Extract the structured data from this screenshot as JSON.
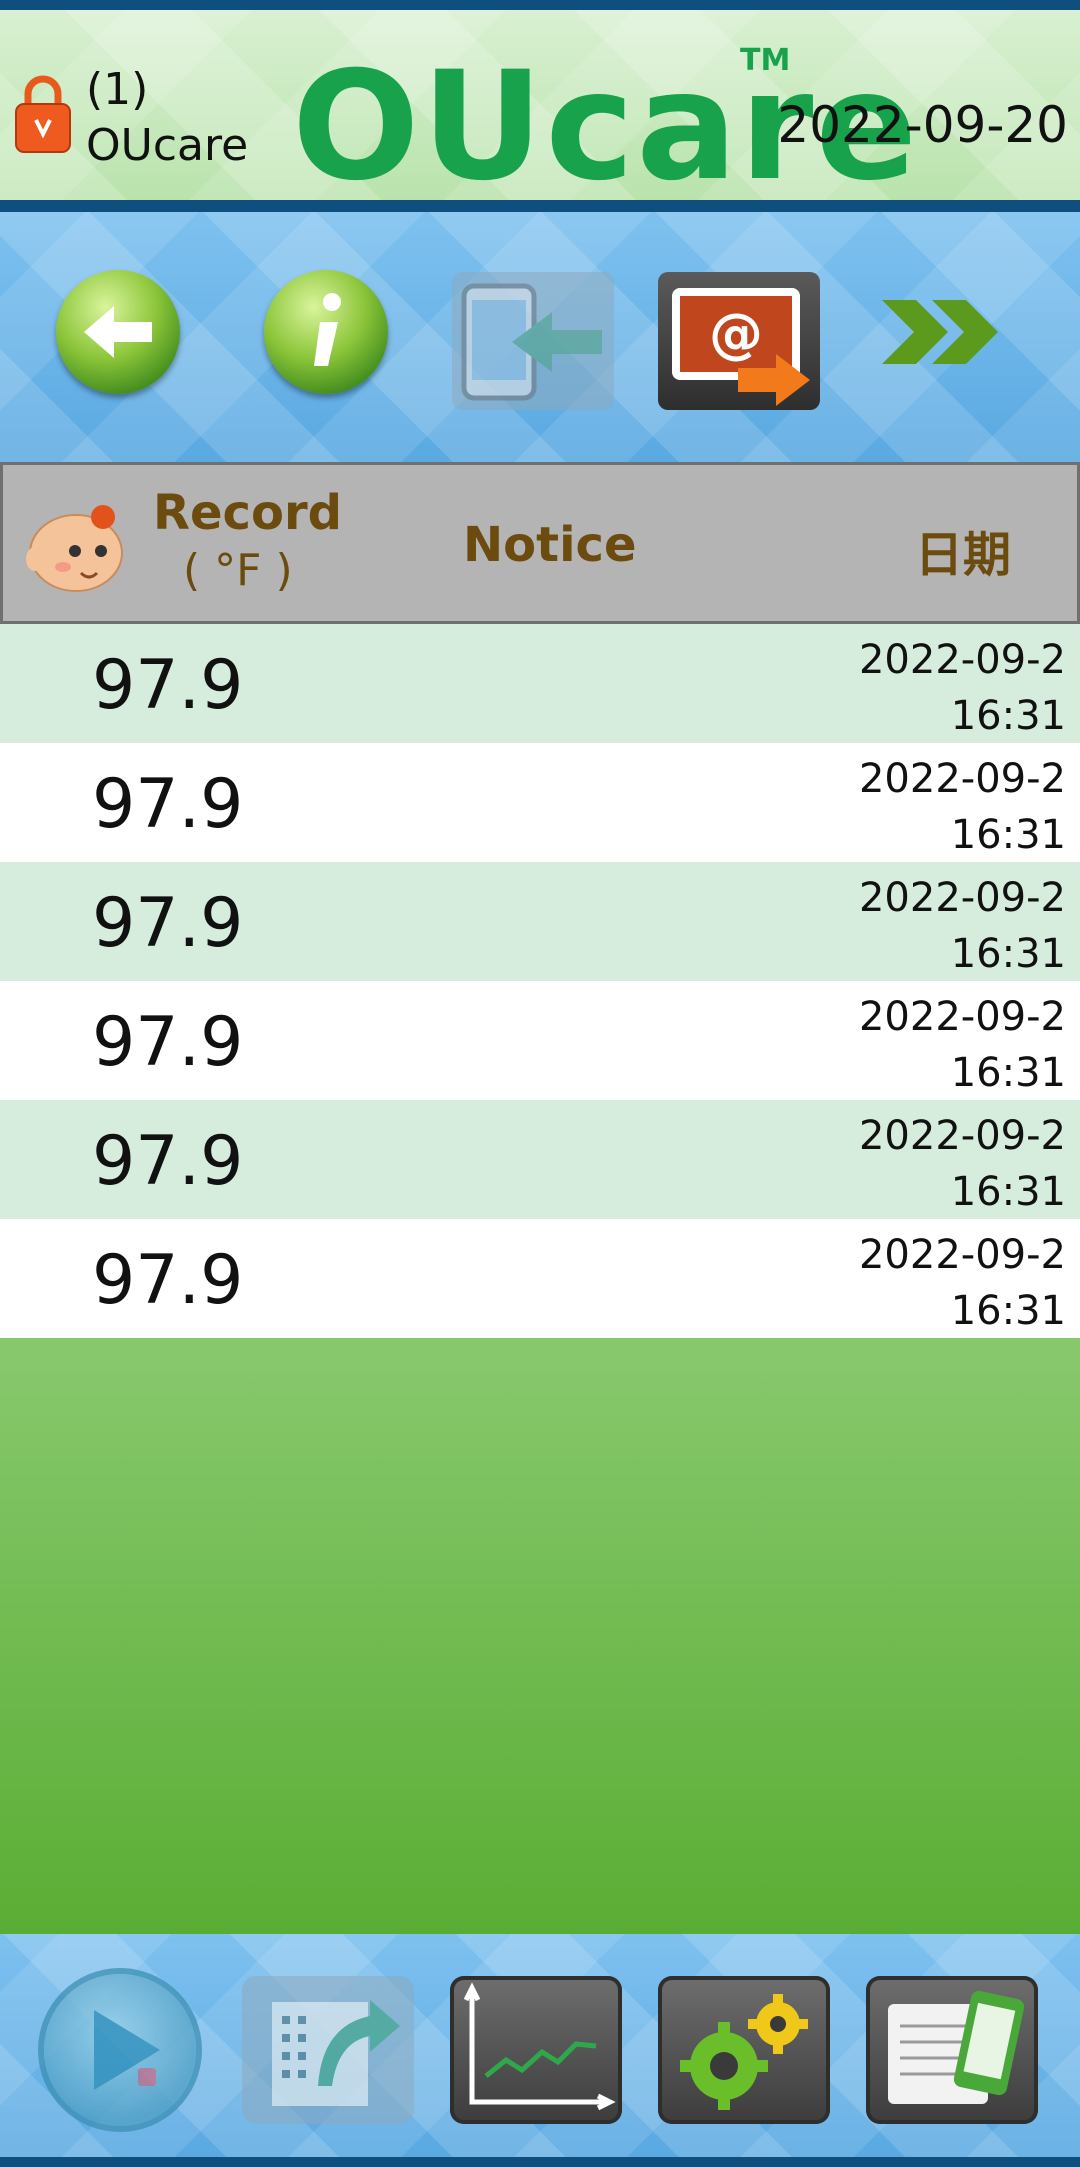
{
  "header": {
    "user_index": "(1)",
    "user_name": "OUcare",
    "logo_text": "OUcare",
    "logo_tm": "TM",
    "date": "2022-09-20"
  },
  "toolbar": {
    "icons": [
      "back-arrow-icon",
      "info-icon",
      "phone-import-icon",
      "email-export-icon",
      "double-chevron-right-icon"
    ]
  },
  "table": {
    "headers": {
      "record": "Record",
      "unit": "( °F )",
      "notice": "Notice",
      "date": "日期"
    },
    "rows": [
      {
        "value": "97.9",
        "notice": "",
        "date": "2022-09-2",
        "time": "16:31"
      },
      {
        "value": "97.9",
        "notice": "",
        "date": "2022-09-2",
        "time": "16:31"
      },
      {
        "value": "97.9",
        "notice": "",
        "date": "2022-09-2",
        "time": "16:31"
      },
      {
        "value": "97.9",
        "notice": "",
        "date": "2022-09-2",
        "time": "16:31"
      },
      {
        "value": "97.9",
        "notice": "",
        "date": "2022-09-2",
        "time": "16:31"
      },
      {
        "value": "97.9",
        "notice": "",
        "date": "2022-09-2",
        "time": "16:31"
      }
    ]
  },
  "bottom_nav": {
    "icons": [
      "play-record-icon",
      "export-file-icon",
      "chart-icon",
      "settings-gears-icon",
      "notes-phone-icon"
    ]
  },
  "colors": {
    "header_border": "#0e4f7d",
    "logo_green": "#18a24b",
    "header_text_brown": "#6b4b0e",
    "row_alt": "#d6ecdc"
  }
}
